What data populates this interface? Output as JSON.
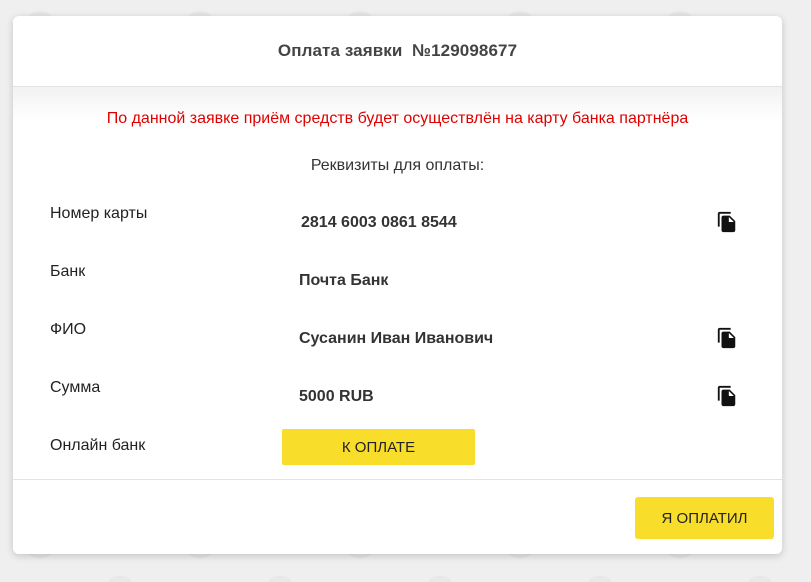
{
  "modal": {
    "title": "Оплата заявки  №129098677",
    "warning": "По данной заявке приём средств будет осуществлён на карту банка партнёра",
    "subtitle": "Реквизиты для оплаты:"
  },
  "rows": {
    "card": {
      "label": "Номер карты",
      "value": "2814 6003 0861 8544",
      "icon": "copy-icon"
    },
    "bank": {
      "label": "Банк",
      "value": "Почта Банк"
    },
    "name": {
      "label": "ФИО",
      "value": "Сусанин Иван Иванович",
      "icon": "copy-icon"
    },
    "amount": {
      "label": "Сумма",
      "value": "5000 RUB",
      "icon": "copy-icon"
    },
    "online": {
      "label": "Онлайн банк",
      "button": "К ОПЛАТЕ"
    }
  },
  "footer": {
    "paid_button": "Я ОПЛАТИЛ"
  },
  "colors": {
    "accent": "#f8dd2a",
    "warning": "#e00000"
  }
}
